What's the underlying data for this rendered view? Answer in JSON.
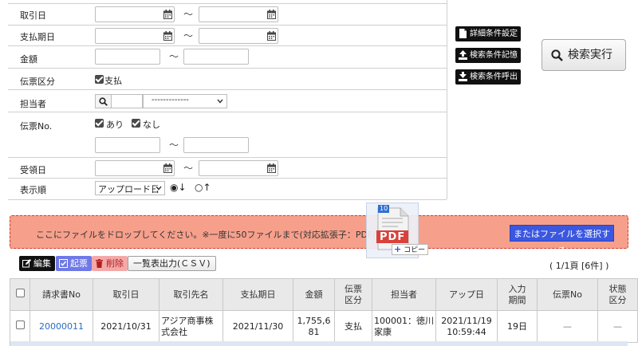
{
  "filters": {
    "torihikibi_label": "取引日",
    "shiharai_label": "支払期日",
    "kingaku_label": "金額",
    "denpyo_kubun_label": "伝票区分",
    "denpyo_kubun_option": "支払",
    "tantousha_label": "担当者",
    "tantousha_select": "-------------",
    "denpyo_no_label": "伝票No.",
    "denpyo_no_ari": "あり",
    "denpyo_no_nashi": "なし",
    "juryobi_label": "受領日",
    "hyoujijun_label": "表示順",
    "hyoujijun_select": "アップロード日",
    "sort_desc": "◉↓",
    "sort_asc": "○↑",
    "tilde": "～"
  },
  "side_buttons": {
    "detail": "詳細条件設定",
    "save": "検索条件記憶",
    "recall": "検索条件呼出",
    "search": "検索実行"
  },
  "dropzone": {
    "text": "ここにファイルをドロップしてください。※一度に50ファイルまで(対応拡張子：PDF/jpeg)",
    "select_button": "またはファイルを選択する",
    "pdf_badge": "PDF",
    "pdf_num": "10",
    "copy_label": "コピー"
  },
  "toolbar": {
    "edit": "編集",
    "kihyo": "起票",
    "delete": "削除",
    "export": "一覧表出力(ＣＳＶ)",
    "pager": "( 1/1頁 [6件] )"
  },
  "table": {
    "headers": [
      "",
      "請求書No",
      "取引日",
      "取引先名",
      "支払期日",
      "金額",
      "伝票\n区分",
      "担当者",
      "アップ日",
      "入力\n期間",
      "伝票No",
      "状態\n区分"
    ],
    "rows": [
      [
        "",
        "20000011",
        "2021/10/31",
        "アジア商事株\n式会社",
        "2021/11/30",
        "1,755,6\n81",
        "支払",
        "100001：徳川\n家康",
        "2021/11/19\n10:59:44",
        "19日",
        "—",
        "—"
      ]
    ]
  },
  "colors": {
    "drop_bg": "#f6a08c",
    "drop_border": "#d03a2a",
    "select_btn": "#3b57e0",
    "edit_btn": "#111111",
    "kihyo_btn": "#6f79e6",
    "delete_btn": "#f4a9a9"
  }
}
